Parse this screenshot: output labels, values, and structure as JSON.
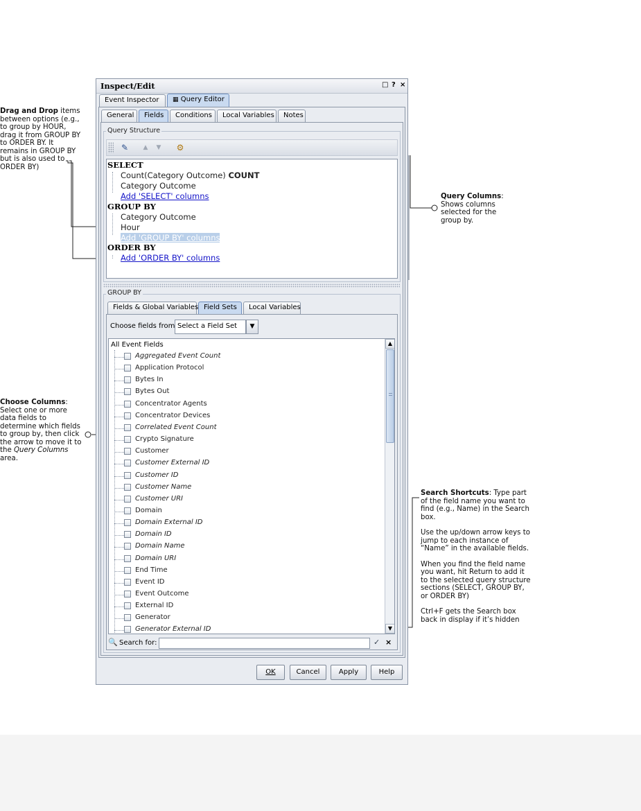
{
  "window": {
    "title": "Inspect/Edit",
    "controls": [
      "□",
      "?",
      "×"
    ]
  },
  "main_tabs": [
    {
      "label": "Event Inspector",
      "active": false
    },
    {
      "label": "Query Editor",
      "active": true
    }
  ],
  "sub_tabs": [
    {
      "label": "General",
      "active": false
    },
    {
      "label": "Fields",
      "active": true
    },
    {
      "label": "Conditions",
      "active": false
    },
    {
      "label": "Local Variables",
      "active": false
    },
    {
      "label": "Notes",
      "active": false
    }
  ],
  "query_structure": {
    "label": "Query Structure",
    "toolbar": [
      "edit-icon",
      "up-arrow-icon",
      "down-arrow-icon",
      "fields-icon"
    ],
    "select": {
      "heading": "SELECT",
      "items": [
        {
          "text": "Count(Category Outcome)",
          "bold_suffix": "COUNT"
        },
        {
          "text": "Category Outcome",
          "bold_suffix": ""
        }
      ],
      "add_link": "Add 'SELECT' columns"
    },
    "group_by": {
      "heading": "GROUP BY",
      "items": [
        "Category Outcome",
        "Hour"
      ],
      "add_link": "Add 'GROUP BY' columns"
    },
    "order_by": {
      "heading": "ORDER BY",
      "add_link": "Add 'ORDER BY' columns"
    }
  },
  "group_by_panel": {
    "label": "GROUP BY",
    "tabs": [
      {
        "label": "Fields & Global Variables",
        "active": false
      },
      {
        "label": "Field Sets",
        "active": true
      },
      {
        "label": "Local Variables",
        "active": false
      }
    ],
    "choose_label": "Choose fields from:",
    "choose_value": "Select a Field Set",
    "root": "All Event Fields",
    "fields": [
      {
        "label": "Aggregated Event Count",
        "italic": true
      },
      {
        "label": "Application Protocol",
        "italic": false
      },
      {
        "label": "Bytes In",
        "italic": false
      },
      {
        "label": "Bytes Out",
        "italic": false
      },
      {
        "label": "Concentrator Agents",
        "italic": false
      },
      {
        "label": "Concentrator Devices",
        "italic": false
      },
      {
        "label": "Correlated Event Count",
        "italic": true
      },
      {
        "label": "Crypto Signature",
        "italic": false
      },
      {
        "label": "Customer",
        "italic": false
      },
      {
        "label": "Customer External ID",
        "italic": true
      },
      {
        "label": "Customer ID",
        "italic": true
      },
      {
        "label": "Customer Name",
        "italic": true
      },
      {
        "label": "Customer URI",
        "italic": true
      },
      {
        "label": "Domain",
        "italic": false
      },
      {
        "label": "Domain External ID",
        "italic": true
      },
      {
        "label": "Domain ID",
        "italic": true
      },
      {
        "label": "Domain Name",
        "italic": true
      },
      {
        "label": "Domain URI",
        "italic": true
      },
      {
        "label": "End Time",
        "italic": false
      },
      {
        "label": "Event ID",
        "italic": false
      },
      {
        "label": "Event Outcome",
        "italic": false
      },
      {
        "label": "External ID",
        "italic": false
      },
      {
        "label": "Generator",
        "italic": false
      },
      {
        "label": "Generator External ID",
        "italic": true
      }
    ],
    "search_label": "Search for:",
    "search_value": ""
  },
  "buttons": {
    "ok": "OK",
    "cancel": "Cancel",
    "apply": "Apply",
    "help": "Help"
  },
  "annotations": {
    "drag_drop": {
      "title": "Drag and Drop",
      "text": " items between options (e.g., to group by HOUR, drag it from GROUP BY to ORDER BY. It remains in GROUP BY but is also used to ORDER BY)"
    },
    "query_columns": {
      "title": "Query Columns",
      "text": ": Shows columns selected for the group by."
    },
    "choose_columns": {
      "title": "Choose Columns",
      "text_a": ": Select one or more data fields to determine which fields to group by, then click the arrow to move it to the ",
      "text_italic": "Query Columns",
      "text_b": " area."
    },
    "search_shortcuts": {
      "title": "Search Shortcuts",
      "paragraphs": [
        ": Type part of the field name you want to find (e.g., Name) in the Search box.",
        "Use the up/down arrow keys to jump to each instance of “Name” in the available fields.",
        "When you find the field name you want, hit Return to add it to the selected query structure sections (SELECT, GROUP BY, or ORDER BY)",
        "Ctrl+F gets the Search box back in display  if it’s hidden"
      ]
    }
  }
}
